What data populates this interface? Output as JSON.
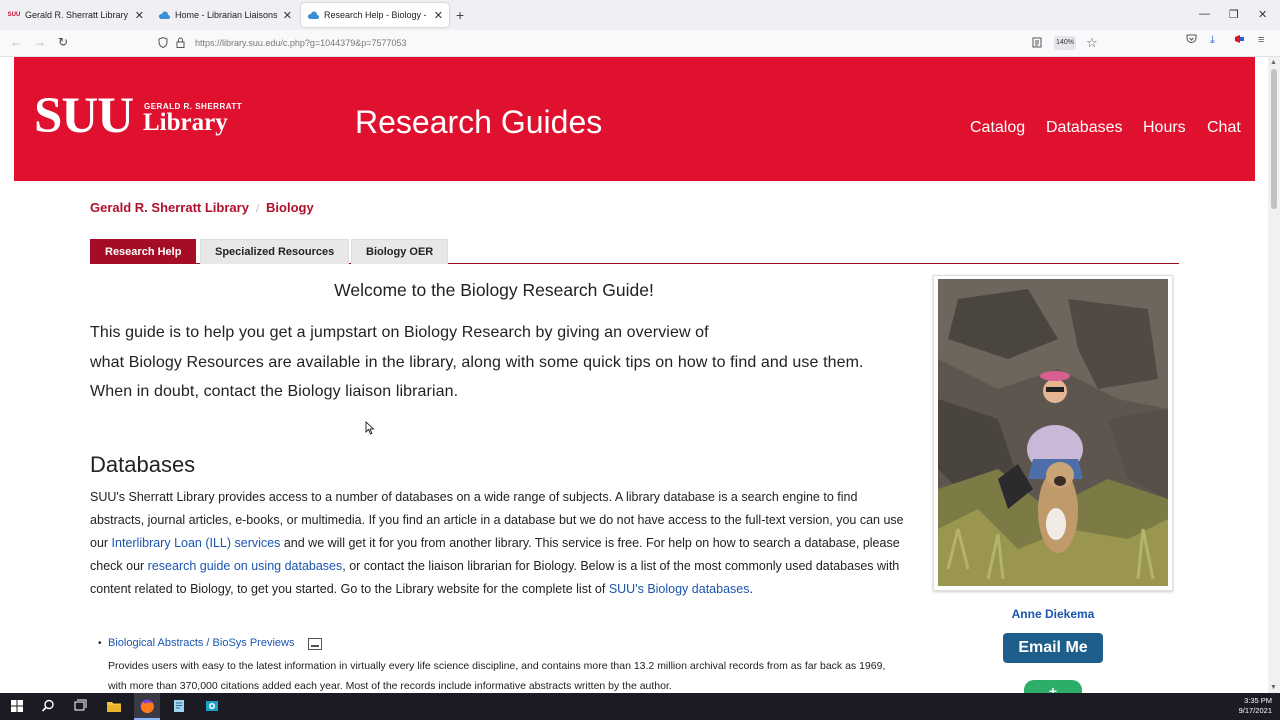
{
  "browser": {
    "tabs": [
      {
        "label": "Gerald R. Sherratt Library | SUU",
        "active": false
      },
      {
        "label": "Home - Librarian Liaisons - Research",
        "active": false
      },
      {
        "label": "Research Help - Biology - Research",
        "active": true
      }
    ],
    "url": "https://library.suu.edu/c.php?g=1044379&p=7577053",
    "zoom": "140%"
  },
  "banner": {
    "logo_main": "SUU",
    "logo_sub": "GERALD R. SHERRATT",
    "logo_library": "Library",
    "title": "Research Guides",
    "nav": [
      "Catalog",
      "Databases",
      "Hours",
      "Chat"
    ]
  },
  "breadcrumb": [
    "Gerald R. Sherratt Library",
    "Biology"
  ],
  "guide_tabs": [
    {
      "label": "Research Help",
      "active": true
    },
    {
      "label": "Specialized Resources",
      "active": false
    },
    {
      "label": "Biology OER",
      "active": false
    }
  ],
  "content": {
    "welcome": "Welcome to the Biology Research Guide!",
    "intro_line1": "This guide is to help you get a jumpstart on Biology Research by giving an overview of",
    "intro_line2": "what Biology Resources are available in the library, along with some quick tips on how to find and use them.",
    "intro_line3": "When in doubt, contact the Biology liaison librarian.",
    "db_heading": "Databases",
    "db_para_1": "SUU's Sherratt Library provides access to a number of databases on a wide range of subjects. A library database is a search engine to find abstracts, journal articles, e-books, or multimedia. If you find an article in a database but we do not have access to the full-text version, you can use our ",
    "db_link_ill": "Interlibrary Loan (ILL) services",
    "db_para_2": " and we will get it for you from another library. This service is free. For help on how to search a database, please check our ",
    "db_link_guide": "research guide on using databases",
    "db_para_3": ", or contact the liaison librarian for Biology. Below is a list of the most commonly used databases with content related to Biology, to get you started. Go to the Library website for the complete list of ",
    "db_link_biology": "SUU's Biology databases",
    "db_para_4": ".",
    "db_item_title": "Biological Abstracts / BioSys Previews",
    "db_item_desc": "Provides users with easy to the latest information in virtually every life science discipline, and contains more than 13.2 million archival records from as far back as 1969, with more than 370,000 citations added each year. Most of the records include informative abstracts written by the author."
  },
  "profile": {
    "name": "Anne Diekema",
    "email_button": "Email Me",
    "extra_button": "+"
  },
  "taskbar": {
    "time": "3:35 PM",
    "date": "9/17/2021"
  },
  "colors": {
    "brand_red": "#e0102f",
    "tab_active": "#a50d26",
    "link": "#1a55b0",
    "email_button": "#1d5f8a"
  }
}
